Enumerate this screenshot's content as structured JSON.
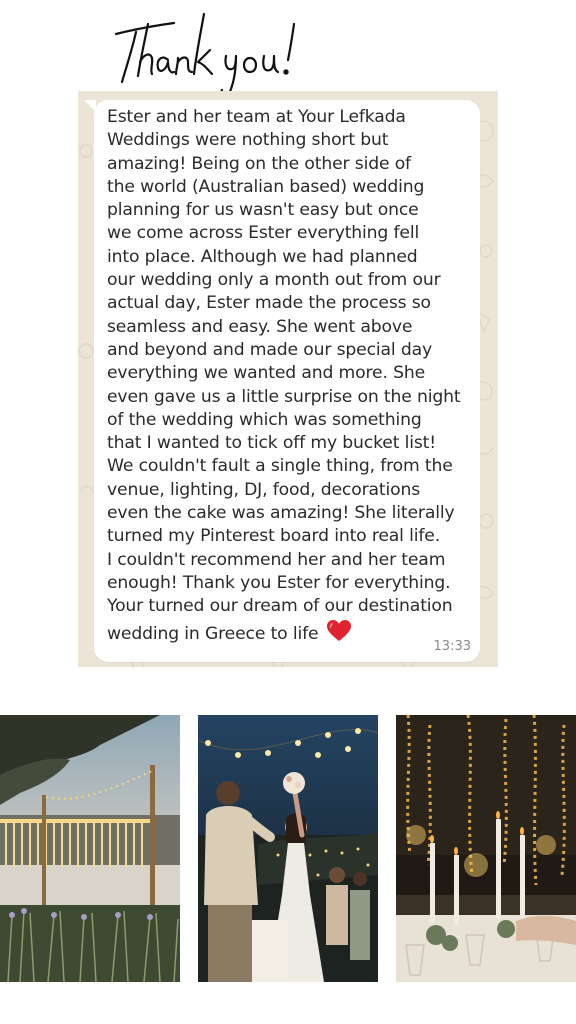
{
  "heading": "Thank you!",
  "message": {
    "lines": [
      "Ester and her team at Your Lefkada",
      "Weddings were nothing short but",
      "amazing! Being on the other side of",
      "the world (Australian based) wedding",
      "planning for us wasn't easy but once",
      "we come across Ester everything fell",
      "into place. Although we had planned",
      "our wedding only a month out from our",
      "actual day, Ester made the process so",
      "seamless and easy. She went above",
      "and beyond and made our special day",
      "everything we wanted and more. She",
      "even gave us a little surprise on the night",
      "of the wedding which was something",
      "that I wanted to tick off my bucket list!",
      "We couldn't fault a single thing, from the",
      "venue, lighting, DJ, food, decorations",
      "even the cake was amazing! She literally",
      "turned my Pinterest board into real life.",
      "I couldn't recommend her and her team",
      "enough! Thank you Ester for everything.",
      "Your turned our dream of our destination",
      "wedding in Greece to life"
    ],
    "emoji": "heart-emoji",
    "time": "13:33"
  },
  "colors": {
    "chat_background": "#ede4d8",
    "bubble": "#ffffff",
    "text": "#2b2b2b",
    "heart": "#e0242f"
  },
  "photos": [
    {
      "name": "outdoor-lights-venue-photo"
    },
    {
      "name": "bride-bouquet-toss-photo"
    },
    {
      "name": "string-lights-table-photo"
    }
  ]
}
